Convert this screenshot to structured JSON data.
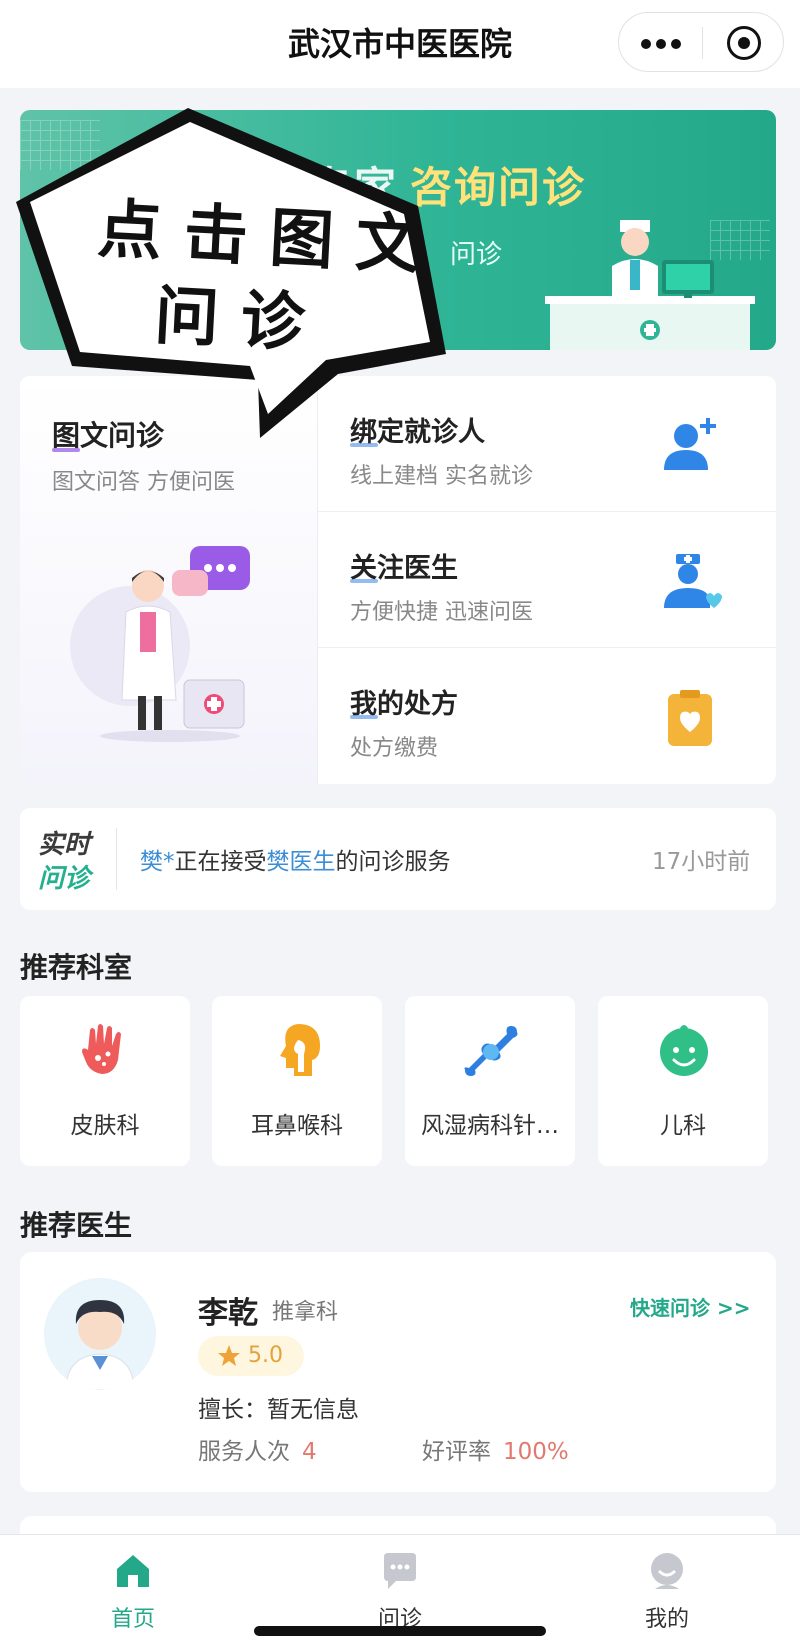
{
  "window": {
    "title": "武汉市中医医院"
  },
  "banner": {
    "headline_prefix": "专家",
    "headline": "咨询问诊",
    "subtitle": "问诊"
  },
  "overlay": {
    "line1": "点击图文",
    "line2": "问诊"
  },
  "services": {
    "main": {
      "title": "图文问诊",
      "subtitle": "图文问答 方便问医"
    },
    "rows": [
      {
        "title": "绑定就诊人",
        "subtitle": "线上建档 实名就诊",
        "icon": "add-user-icon"
      },
      {
        "title": "关注医生",
        "subtitle": "方便快捷 迅速问医",
        "icon": "doctor-heart-icon"
      },
      {
        "title": "我的处方",
        "subtitle": "处方缴费",
        "icon": "prescription-icon"
      }
    ]
  },
  "live": {
    "logo_line1": "实时",
    "logo_line2": "问诊",
    "patient": "樊*",
    "text1": "正在接受",
    "doctor": "樊医生",
    "text2": "的问诊服务",
    "time": "17小时前"
  },
  "departments": {
    "title": "推荐科室",
    "items": [
      {
        "label": "皮肤科",
        "icon": "skin-icon",
        "color": "#ef5a5a"
      },
      {
        "label": "耳鼻喉科",
        "icon": "ent-icon",
        "color": "#f5a623"
      },
      {
        "label": "风湿病科针…",
        "icon": "bone-joint-icon",
        "color": "#2f7fe0"
      },
      {
        "label": "儿科",
        "icon": "baby-face-icon",
        "color": "#2fbf87"
      }
    ]
  },
  "doctors": {
    "title": "推荐医生",
    "items": [
      {
        "name": "李乾",
        "dept": "推拿科",
        "quick_label": "快速问诊 >>",
        "rating": "5.0",
        "expertise": "擅长：暂无信息",
        "service_label": "服务人次",
        "service_count": "4",
        "good_label": "好评率",
        "good_rate": "100%"
      }
    ]
  },
  "tabbar": {
    "tabs": [
      {
        "label": "首页",
        "icon": "home-icon",
        "active": true
      },
      {
        "label": "问诊",
        "icon": "chat-icon",
        "active": false
      },
      {
        "label": "我的",
        "icon": "profile-icon",
        "active": false
      }
    ]
  },
  "colors": {
    "accent": "#24a88a",
    "link": "#3b8ed6",
    "rating": "#e3a23a"
  }
}
